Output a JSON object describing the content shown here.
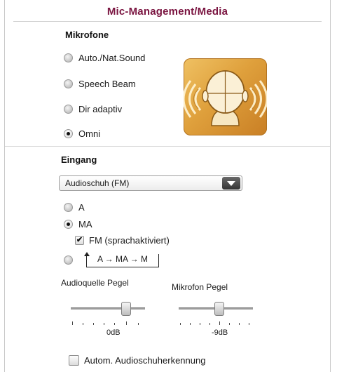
{
  "window": {
    "title": "Mic-Management/Media"
  },
  "mikrofone": {
    "heading": "Mikrofone",
    "options": [
      {
        "label": "Auto./Nat.Sound",
        "checked": false
      },
      {
        "label": "Speech Beam",
        "checked": false
      },
      {
        "label": "Dir adaptiv",
        "checked": false
      },
      {
        "label": "Omni",
        "checked": true
      }
    ],
    "illustration": "omni-microphone-icon"
  },
  "eingang": {
    "heading": "Eingang",
    "source_select": {
      "value": "Audioschuh (FM)"
    },
    "options": [
      {
        "label": "A",
        "checked": false
      },
      {
        "label": "MA",
        "checked": true
      }
    ],
    "fm_checkbox": {
      "label": "FM (sprachaktiviert)",
      "checked": true
    },
    "route_option": {
      "label": "A → MA → M",
      "checked": false
    }
  },
  "sliders": {
    "audio_source": {
      "label": "Audioquelle Pegel",
      "value": "0dB"
    },
    "microphone": {
      "label": "Mikrofon Pegel",
      "value": "-9dB"
    }
  },
  "auto_detect": {
    "label": "Autom. Audioschuherkennung",
    "checked": false
  },
  "colors": {
    "title": "#7a1440",
    "tile": "#dfa03c"
  }
}
